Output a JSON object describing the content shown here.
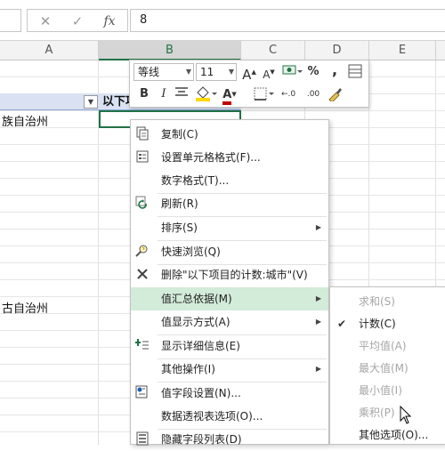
{
  "formula_bar": {
    "cancel_icon": "✕",
    "enter_icon": "✓",
    "fx_label": "fx",
    "value": "8"
  },
  "columns": [
    "A",
    "B",
    "C",
    "D",
    "E"
  ],
  "sheet": {
    "pivot_header": "以下项目的计数:城市",
    "filter_icon": "▼",
    "row_label_1": "族自治州",
    "row_label_2": "古自治州"
  },
  "mini_toolbar": {
    "font_name": "等线",
    "font_size": "11",
    "increase_font": "A",
    "decrease_font": "A",
    "percent": "%",
    "comma": ",",
    "bold": "B",
    "italic": "I",
    "font_color_letter": "A",
    "inc_decimal": "←.0",
    "dec_decimal": ".00",
    "colors": {
      "font_color": "#c00000",
      "fill_color": "#ffd700"
    }
  },
  "context_menu": {
    "items": [
      {
        "label": "复制(C)",
        "icon": "copy-icon"
      },
      {
        "label": "设置单元格格式(F)...",
        "icon": "format-cells-icon"
      },
      {
        "label": "数字格式(T)...",
        "icon": ""
      },
      {
        "label": "刷新(R)",
        "icon": "refresh-icon"
      },
      {
        "label": "排序(S)",
        "icon": "",
        "submenu": true
      },
      {
        "label": "快速浏览(Q)",
        "icon": "quick-explore-icon"
      },
      {
        "label": "删除\"以下项目的计数:城市\"(V)",
        "icon": "delete-x-icon"
      },
      {
        "label": "值汇总依据(M)",
        "icon": "",
        "submenu": true,
        "highlighted": true
      },
      {
        "label": "值显示方式(A)",
        "icon": "",
        "submenu": true
      },
      {
        "label": "显示详细信息(E)",
        "icon": "show-detail-icon"
      },
      {
        "label": "其他操作(I)",
        "icon": "",
        "submenu": true
      },
      {
        "label": "值字段设置(N)...",
        "icon": "field-settings-icon"
      },
      {
        "label": "数据透视表选项(O)...",
        "icon": ""
      },
      {
        "label": "隐藏字段列表(D)",
        "icon": "field-list-icon"
      }
    ],
    "submenu_arrow": "▶"
  },
  "submenu": {
    "check_mark": "✔",
    "items": [
      {
        "label": "求和(S)",
        "disabled": true
      },
      {
        "label": "计数(C)",
        "checked": true
      },
      {
        "label": "平均值(A)",
        "disabled": true
      },
      {
        "label": "最大值(M)",
        "disabled": true
      },
      {
        "label": "最小值(I)",
        "disabled": true
      },
      {
        "label": "乘积(P)",
        "disabled": true
      },
      {
        "label": "其他选项(O)..."
      }
    ]
  },
  "colors": {
    "accent_green": "#217346",
    "menu_highlight": "#d3ebd9",
    "pivot_header_fill": "#d9e1f2"
  }
}
